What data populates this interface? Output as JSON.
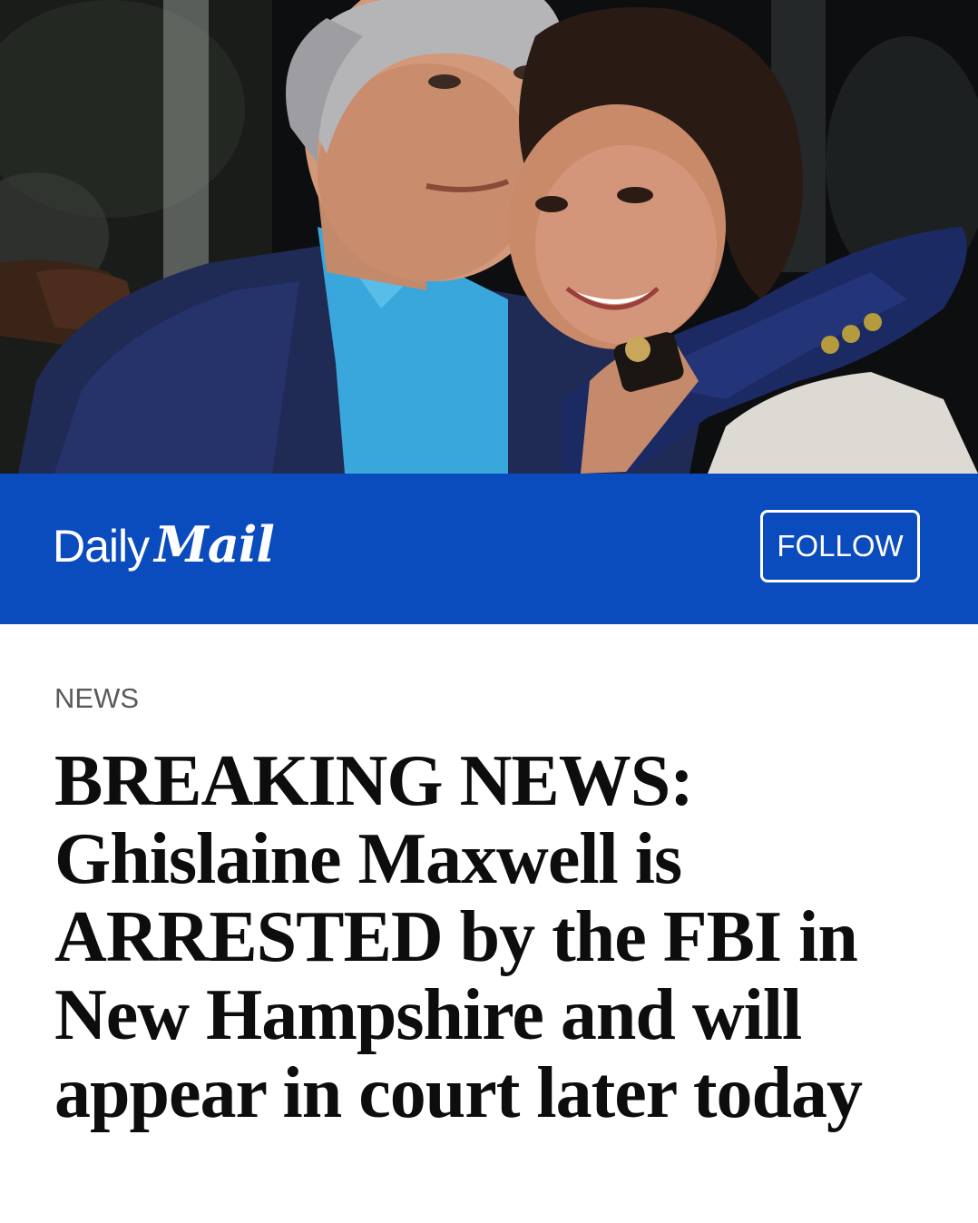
{
  "hero": {
    "image": "photo-of-couple-embracing"
  },
  "brand": {
    "logo_daily": "Daily",
    "logo_mail": "Mail",
    "follow_label": "FOLLOW",
    "bar_color": "#0a4cbd"
  },
  "article": {
    "category": "NEWS",
    "headline": "BREAKING NEWS: Ghislaine Maxwell is ARRESTED by the FBI in New Hampshire and will appear in court later today"
  }
}
